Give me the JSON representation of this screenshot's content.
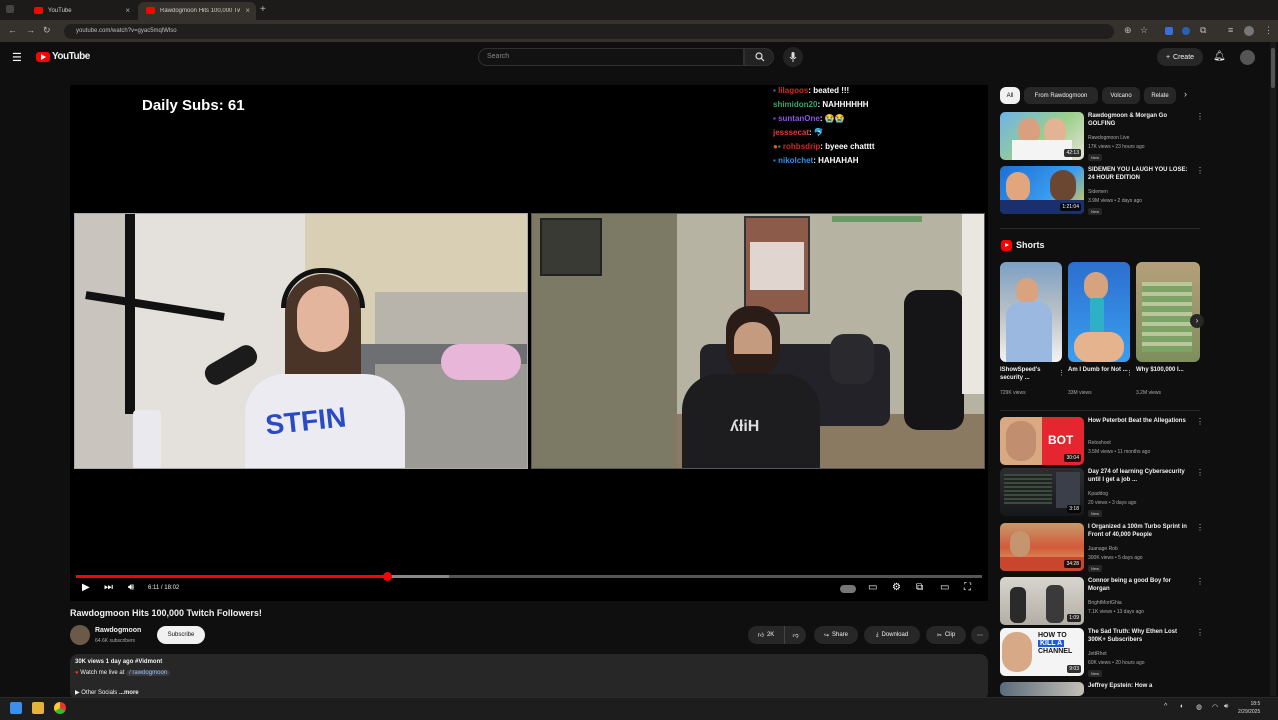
{
  "browser": {
    "tabs": [
      {
        "label": "YouTube"
      },
      {
        "label": "Rawdogmoon Hits 100,000 Twi..."
      }
    ],
    "url": "youtube.com/watch?v=gyac5mqlWlso"
  },
  "header": {
    "logo": "YouTube",
    "search_placeholder": "Search",
    "create_label": "Create"
  },
  "player": {
    "overlay_text": "Daily Subs: 61",
    "chat": [
      {
        "user": "lilagoos",
        "message": "beated !!!"
      },
      {
        "user": "shimidon20",
        "message": "NAHHHHHH"
      },
      {
        "user": "suntanOne",
        "message": "😭😭"
      },
      {
        "user": "jesssecat",
        "message": "🐬"
      },
      {
        "user": "rohbsdrip",
        "message": "byeee chatttt"
      },
      {
        "user": "nikolchet",
        "message": "HAHAHAH"
      }
    ],
    "time": "6:11 / 18:02",
    "progress_fraction": 0.343,
    "buffered_fraction": 0.412
  },
  "video": {
    "title": "Rawdogmoon Hits 100,000 Twitch Followers!",
    "channel": "Rawdogmoon",
    "subscribers": "64.6K subscribers",
    "subscribe_label": "Subscribe",
    "likes": "2K",
    "share_label": "Share",
    "download_label": "Download",
    "clip_label": "Clip",
    "desc_meta": "30K views  1 day ago  #Vidmont",
    "desc_line2": "Watch me live at",
    "desc_link": "/ rawdogmoon",
    "desc_line3": "▶ Other Socials",
    "desc_more": "...more"
  },
  "sidebar": {
    "chips": [
      "All",
      "From Rawdogmoon",
      "Volcano",
      "Relate"
    ],
    "top_recs": [
      {
        "title": "Rawdogmoon & Morgan Go GOLFING",
        "channel": "Rawdogmoon Live",
        "meta": "17K views • 23 hours ago",
        "badge": "New",
        "duration": "42:13"
      },
      {
        "title": "SIDEMEN YOU LAUGH YOU LOSE: 24 HOUR EDITION",
        "channel": "Sidemen",
        "meta": "3.9M views • 2 days ago",
        "badge": "New",
        "duration": "1:21:04"
      }
    ],
    "shorts_label": "Shorts",
    "shorts": [
      {
        "title": "IShowSpeed's security ...",
        "views": "729K views"
      },
      {
        "title": "Am I Dumb for Not ...",
        "views": "33M views"
      },
      {
        "title": "Why $100,000 I...",
        "views": "3.2M views"
      }
    ],
    "recs": [
      {
        "title": "How Peterbot Beat the Allegations",
        "channel": "Retoshoot",
        "meta": "3.5M views • 11 months ago",
        "badge": "",
        "duration": "30:04"
      },
      {
        "title": "Day 274 of learning Cybersecurity until I get a job ...",
        "channel": "Kpaddog",
        "meta": "20 views • 3 days ago",
        "badge": "New",
        "duration": "3:18"
      },
      {
        "title": "I Organized a 100m Turbo Sprint in Front of 40,000 People",
        "channel": "Juanage Rob",
        "meta": "300K views • 5 days ago",
        "badge": "New",
        "duration": "34:28"
      },
      {
        "title": "Connor being a good Boy for Morgan",
        "channel": "BrightMortGhia",
        "meta": "7.1K views • 13 days ago",
        "badge": "",
        "duration": "1:09"
      },
      {
        "title": "The Sad Truth: Why Ethen Lost 300K+ Subscribers",
        "channel": "JettRhet",
        "meta": "60K views • 20 hours ago",
        "badge": "New",
        "duration": "9:03"
      },
      {
        "title": "Jeffrey Epstein: How a",
        "channel": "",
        "meta": "",
        "badge": "",
        "duration": ""
      }
    ]
  },
  "taskbar": {
    "time": "18:5",
    "date": "2/29/2025"
  }
}
